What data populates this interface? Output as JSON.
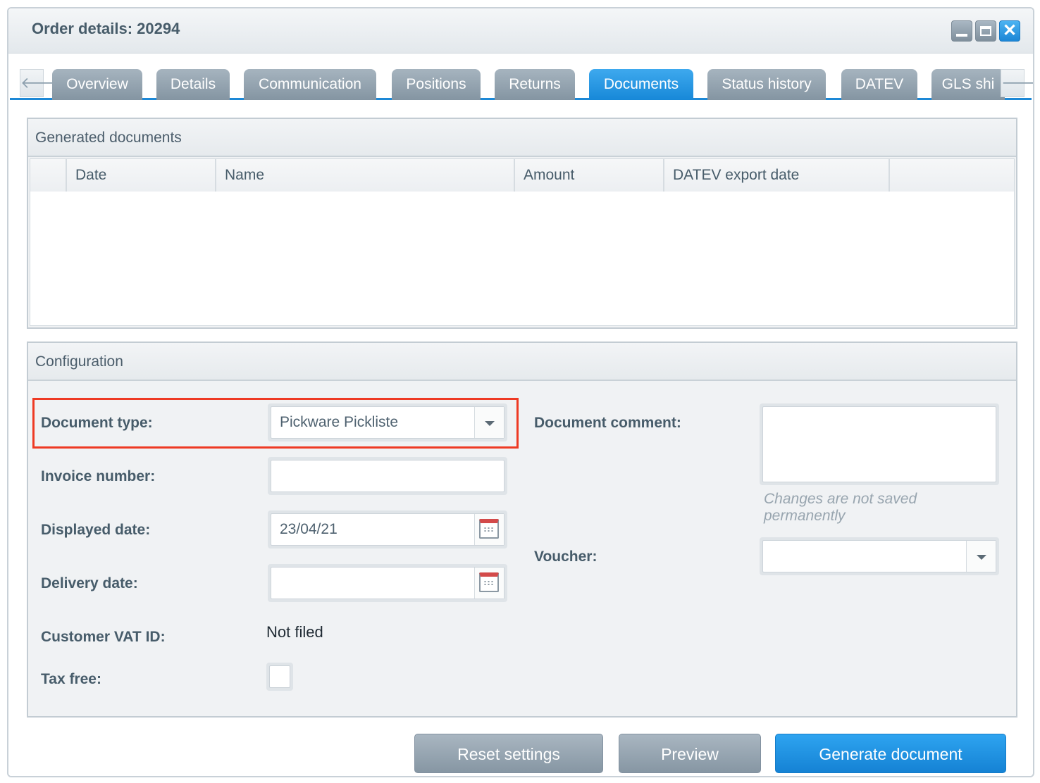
{
  "window": {
    "title": "Order details: 20294",
    "controls": [
      "minimize-icon",
      "maximize-icon",
      "close-icon"
    ]
  },
  "tabs": [
    {
      "label": "Overview",
      "active": false
    },
    {
      "label": "Details",
      "active": false
    },
    {
      "label": "Communication",
      "active": false
    },
    {
      "label": "Positions",
      "active": false
    },
    {
      "label": "Returns",
      "active": false
    },
    {
      "label": "Documents",
      "active": true
    },
    {
      "label": "Status history",
      "active": false
    },
    {
      "label": "DATEV",
      "active": false
    },
    {
      "label": "GLS shi",
      "active": false
    }
  ],
  "generated_documents": {
    "title": "Generated documents",
    "columns": [
      "Date",
      "Name",
      "Amount",
      "DATEV export date"
    ],
    "rows": []
  },
  "configuration": {
    "title": "Configuration",
    "document_type": {
      "label": "Document type:",
      "value": "Pickware Pickliste"
    },
    "invoice_number": {
      "label": "Invoice number:",
      "value": ""
    },
    "displayed_date": {
      "label": "Displayed date:",
      "value": "23/04/21"
    },
    "delivery_date": {
      "label": "Delivery date:",
      "value": ""
    },
    "customer_vat_id": {
      "label": "Customer VAT ID:",
      "value": "Not filed"
    },
    "tax_free": {
      "label": "Tax free:",
      "checked": false
    },
    "document_comment": {
      "label": "Document comment:",
      "value": "",
      "hint": "Changes are not saved permanently"
    },
    "voucher": {
      "label": "Voucher:",
      "value": ""
    }
  },
  "buttons": {
    "reset": "Reset settings",
    "preview": "Preview",
    "generate": "Generate document"
  },
  "colors": {
    "accent": "#1d88d6",
    "highlight": "#ee3a24"
  }
}
